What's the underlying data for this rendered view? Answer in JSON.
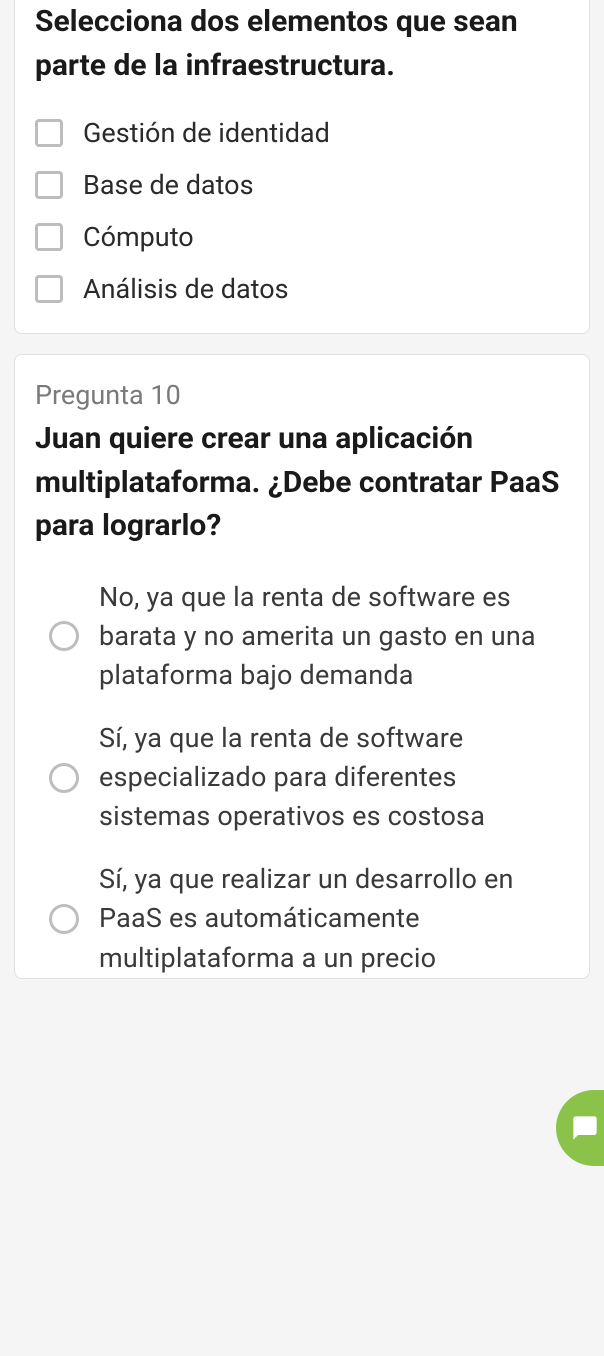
{
  "q9": {
    "text": "Selecciona dos elementos que sean parte de la infraestructura.",
    "options": [
      "Gestión de identidad",
      "Base de datos",
      "Cómputo",
      "Análisis de datos"
    ]
  },
  "q10": {
    "label": "Pregunta 10",
    "text": "Juan quiere crear una aplicación multiplataforma. ¿Debe contratar PaaS para lograrlo?",
    "options": [
      "No, ya que la renta de software es barata y no amerita un gasto en una plataforma bajo demanda",
      "Sí, ya que la renta de software especializado para diferentes sistemas operativos es costosa",
      "Sí, ya que realizar un desarrollo en PaaS es automáticamente multiplataforma a un precio"
    ]
  },
  "fab": {
    "icon": "chat-icon"
  }
}
